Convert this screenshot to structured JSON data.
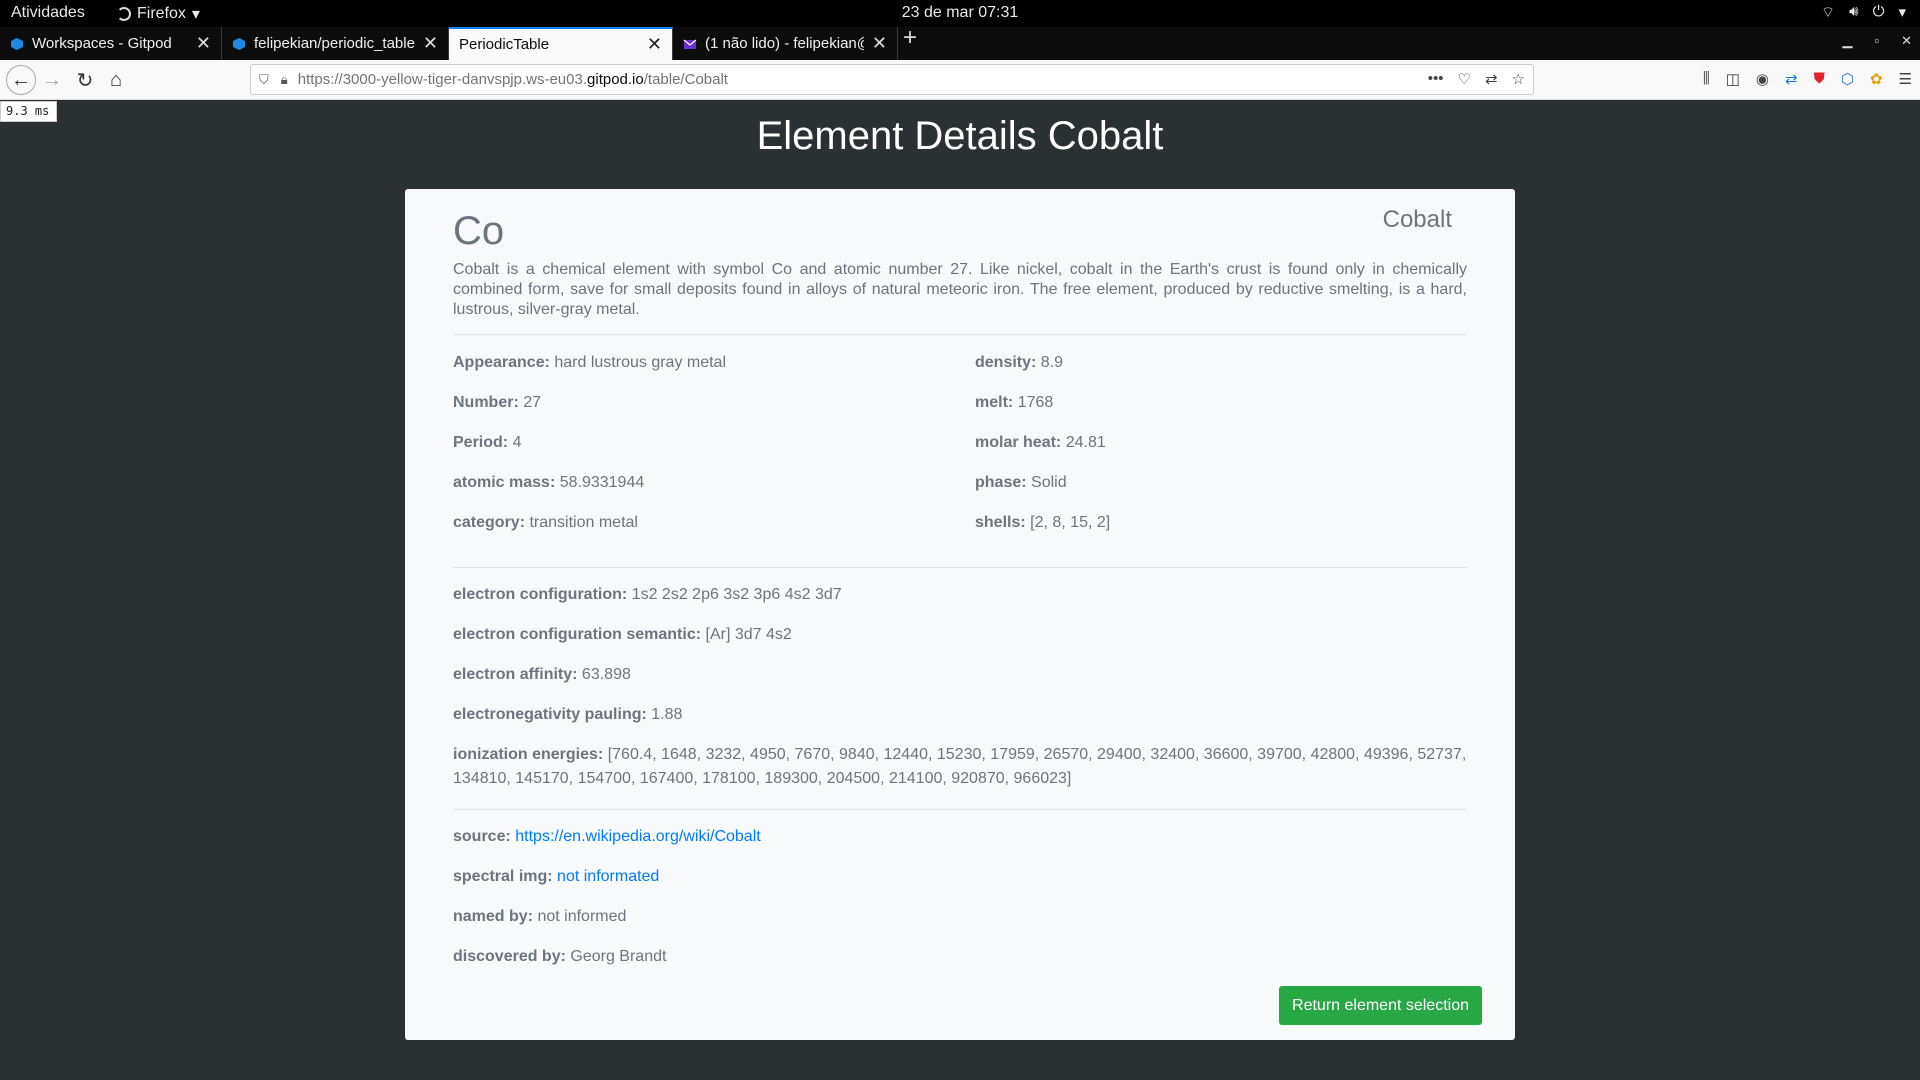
{
  "system_bar": {
    "activities": "Atividades",
    "app_name": "Firefox",
    "datetime": "23 de mar  07:31"
  },
  "tabs": [
    {
      "label": "Workspaces - Gitpod",
      "active": false,
      "icon": "gitpod-icon"
    },
    {
      "label": "felipekian/periodic_table",
      "active": false,
      "icon": "gitpod-icon"
    },
    {
      "label": "PeriodicTable",
      "active": true,
      "icon": ""
    },
    {
      "label": "(1 não lido) - felipekian@",
      "active": false,
      "icon": "mail-icon"
    }
  ],
  "address_bar": {
    "url_prefix": "https://3000-yellow-tiger-danvspjp.ws-eu03.",
    "url_domain": "gitpod.io",
    "url_path": "/table/Cobalt"
  },
  "perf_badge": "9.3 ms",
  "page": {
    "title": "Element Details Cobalt",
    "symbol": "Co",
    "name": "Cobalt",
    "summary": "Cobalt is a chemical element with symbol Co and atomic number 27. Like nickel, cobalt in the Earth's crust is found only in chemically combined form, save for small deposits found in alloys of natural meteoric iron. The free element, produced by reductive smelting, is a hard, lustrous, silver-gray metal.",
    "left_props": [
      {
        "key": "Appearance:",
        "value": "hard lustrous gray metal"
      },
      {
        "key": "Number:",
        "value": "27"
      },
      {
        "key": "Period:",
        "value": "4"
      },
      {
        "key": "atomic mass:",
        "value": "58.9331944"
      },
      {
        "key": "category:",
        "value": "transition metal"
      }
    ],
    "right_props": [
      {
        "key": "density:",
        "value": "8.9"
      },
      {
        "key": "melt:",
        "value": "1768"
      },
      {
        "key": "molar heat:",
        "value": "24.81"
      },
      {
        "key": "phase:",
        "value": "Solid"
      },
      {
        "key": "shells:",
        "value": "[2, 8, 15, 2]"
      }
    ],
    "electron_props": [
      {
        "key": "electron configuration:",
        "value": "1s2 2s2 2p6 3s2 3p6 4s2 3d7"
      },
      {
        "key": "electron configuration semantic:",
        "value": "[Ar] 3d7 4s2"
      },
      {
        "key": "electron affinity:",
        "value": "63.898"
      },
      {
        "key": "electronegativity pauling:",
        "value": "1.88"
      },
      {
        "key": "ionization energies:",
        "value": "[760.4, 1648, 3232, 4950, 7670, 9840, 12440, 15230, 17959, 26570, 29400, 32400, 36600, 39700, 42800, 49396, 52737, 134810, 145170, 154700, 167400, 178100, 189300, 204500, 214100, 920870, 966023]"
      }
    ],
    "source_key": "source:",
    "source_link": "https://en.wikipedia.org/wiki/Cobalt",
    "spectral_key": "spectral img:",
    "spectral_value": "not informated",
    "named_key": "named by:",
    "named_value": "not informed",
    "discovered_key": "discovered by:",
    "discovered_value": "Georg Brandt",
    "return_button": "Return element selection"
  }
}
